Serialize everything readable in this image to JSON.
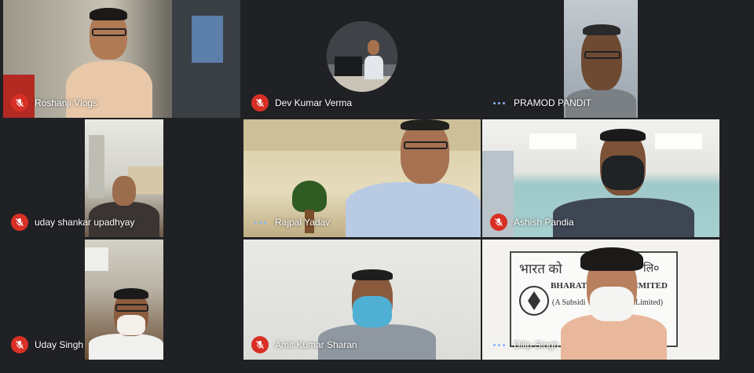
{
  "participants": [
    {
      "name": "Roshanji Vlogs",
      "status": "muted"
    },
    {
      "name": "Dev Kumar Verma",
      "status": "muted"
    },
    {
      "name": "PRAMOD PANDIT",
      "status": "speaking"
    },
    {
      "name": "uday shankar upadhyay",
      "status": "muted"
    },
    {
      "name": "Rajpal Yadav",
      "status": "speaking"
    },
    {
      "name": "Ashish Pandia",
      "status": "muted"
    },
    {
      "name": "Uday Singh",
      "status": "muted"
    },
    {
      "name": "Amit Kumar Sharan",
      "status": "muted"
    },
    {
      "name": "Dilip Singh",
      "status": "speaking"
    }
  ],
  "background_sign": {
    "line1": "भारत को",
    "line1_suffix": "लि०",
    "line2_left": "BHARAT",
    "line2_right": "LIMITED",
    "line3_left": "(A Subsidi",
    "line3_right": "Limited)"
  },
  "colors": {
    "meet_background": "#202124",
    "muted_indicator": "#d93025",
    "speaking_indicator": "#8ab4f8"
  },
  "icons": {
    "muted": "mic-off-icon",
    "speaking": "audio-level-icon"
  }
}
